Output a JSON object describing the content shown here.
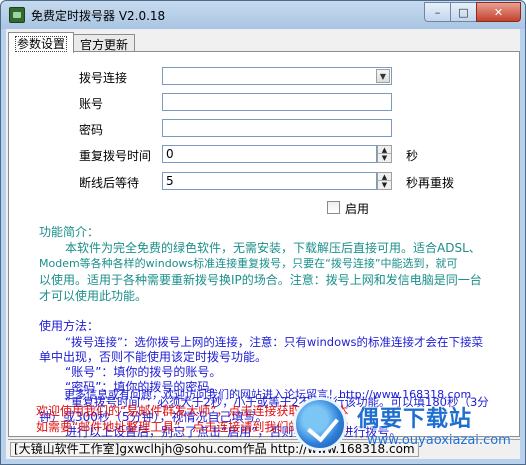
{
  "window": {
    "title": "免费定时拨号器 V2.0.18",
    "min_glyph": "–",
    "max_glyph": "□",
    "close_glyph": "✕"
  },
  "tabs": [
    {
      "label": "参数设置",
      "active": true
    },
    {
      "label": "官方更新",
      "active": false
    }
  ],
  "form": {
    "connection_label": "拨号连接",
    "connection_value": "",
    "account_label": "账号",
    "account_value": "",
    "password_label": "密码",
    "password_value": "",
    "redial_time_label": "重复拨号时间",
    "redial_time_value": "0",
    "redial_time_unit": "秒",
    "wait_label": "断线后等待",
    "wait_value": "5",
    "wait_unit": "秒再重拨",
    "enable_label": "启用",
    "enable_checked": false
  },
  "intro": {
    "heading": "功能简介：",
    "lines": [
      "本软件为完全免费的绿色软件，无需安装，下载解压后直接可用。适合ADSL、",
      "Modem等各种各样的windows标准连接重复拨号，只要在“拨号连接”中能选到，就可",
      "以使用。适用于各种需要重新拨号换IP的场合。注意：拨号上网和发信电脑是同一台",
      "才可以使用此功能。"
    ]
  },
  "usage": {
    "heading": "使用方法：",
    "lines": [
      "“拨号连接”：选你拨号上网的连接，注意：只有windows的标准连接才会在下接菜",
      "单中出现，否则不能使用该定时拨号功能。",
      "“账号”：填你的拨号的账号。",
      "“密码”：填你的拨号的密码。",
      "“重复拨号时间”：必须大于2秒，小于或等于2不会执行该功能。可以填180秒（3分",
      "钟）或300秒（5分钟），视情况自己填写。",
      "进行以上设置后，别忘了点击“启用”，否则不会定时进行拨号。",
      "更多信息或有问题，欢迎访问我们的网站进入论坛留言！http://www.168318.com"
    ]
  },
  "promo": {
    "lines": [
      "欢迎使用我们的“易邮件群发大师”，点击连接获取最新版本",
      "如需要“邮件地址整理工具”，点击连接请到我们的网站下载"
    ]
  },
  "statusbar": {
    "text": "[大镜山软件工作室]gxwclhjh@sohu.com作品 http://www.168318.com"
  },
  "watermark": {
    "title": "偶要下载站",
    "subtitle": "www.ouyaoxiazai.com"
  },
  "colors": {
    "intro_text": "#1a8f8a",
    "usage_text": "#1c1cd6",
    "promo_text": "#e01010"
  }
}
